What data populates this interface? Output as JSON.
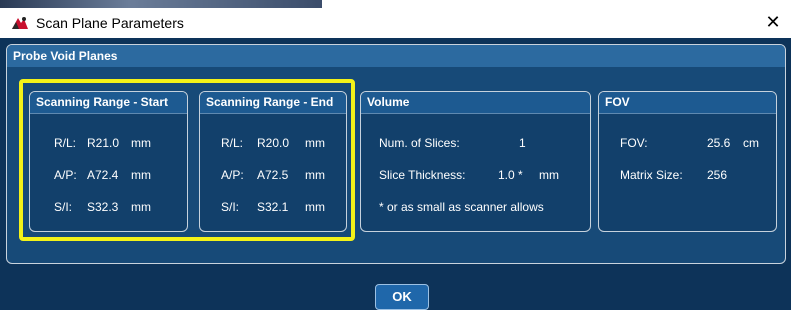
{
  "window": {
    "title": "Scan Plane Parameters",
    "close_glyph": "✕",
    "app_icon": "app-logo-icon"
  },
  "panel": {
    "title": "Probe Void Planes"
  },
  "groups": {
    "start": {
      "title": "Scanning Range - Start",
      "rows": [
        {
          "label": "R/L:",
          "value": "R21.0",
          "unit": "mm"
        },
        {
          "label": "A/P:",
          "value": "A72.4",
          "unit": "mm"
        },
        {
          "label": "S/I:",
          "value": "S32.3",
          "unit": "mm"
        }
      ]
    },
    "end": {
      "title": "Scanning Range - End",
      "rows": [
        {
          "label": "R/L:",
          "value": "R20.0",
          "unit": "mm"
        },
        {
          "label": "A/P:",
          "value": "A72.5",
          "unit": "mm"
        },
        {
          "label": "S/I:",
          "value": "S32.1",
          "unit": "mm"
        }
      ]
    },
    "volume": {
      "title": "Volume",
      "slices_label": "Num. of Slices:",
      "slices_value": "1",
      "thickness_label": "Slice Thickness:",
      "thickness_value": "1.0 *",
      "thickness_unit": "mm",
      "note": "* or as small as scanner allows"
    },
    "fov": {
      "title": "FOV",
      "fov_label": "FOV:",
      "fov_value": "25.6",
      "fov_unit": "cm",
      "matrix_label": "Matrix Size:",
      "matrix_value": "256"
    }
  },
  "footer": {
    "ok_label": "OK"
  },
  "colors": {
    "background": "#0d3359",
    "panel": "#174a78",
    "header": "#2c6aa0",
    "highlight": "#f3f219"
  }
}
